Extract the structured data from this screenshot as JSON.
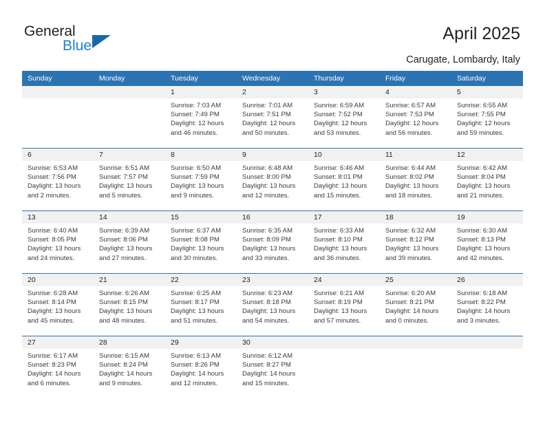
{
  "brand": {
    "name_part1": "General",
    "name_part2": "Blue",
    "accent_color": "#1b7fd4",
    "triangle_color": "#1668ad"
  },
  "header": {
    "title": "April 2025",
    "location": "Carugate, Lombardy, Italy"
  },
  "calendar": {
    "header_color": "#2c73b4",
    "daynum_bg": "#f1f1f1",
    "weekdays": [
      "Sunday",
      "Monday",
      "Tuesday",
      "Wednesday",
      "Thursday",
      "Friday",
      "Saturday"
    ],
    "weeks": [
      [
        {
          "day": "",
          "sunrise": "",
          "sunset": "",
          "daylight_1": "",
          "daylight_2": ""
        },
        {
          "day": "",
          "sunrise": "",
          "sunset": "",
          "daylight_1": "",
          "daylight_2": ""
        },
        {
          "day": "1",
          "sunrise": "Sunrise: 7:03 AM",
          "sunset": "Sunset: 7:49 PM",
          "daylight_1": "Daylight: 12 hours",
          "daylight_2": "and 46 minutes."
        },
        {
          "day": "2",
          "sunrise": "Sunrise: 7:01 AM",
          "sunset": "Sunset: 7:51 PM",
          "daylight_1": "Daylight: 12 hours",
          "daylight_2": "and 50 minutes."
        },
        {
          "day": "3",
          "sunrise": "Sunrise: 6:59 AM",
          "sunset": "Sunset: 7:52 PM",
          "daylight_1": "Daylight: 12 hours",
          "daylight_2": "and 53 minutes."
        },
        {
          "day": "4",
          "sunrise": "Sunrise: 6:57 AM",
          "sunset": "Sunset: 7:53 PM",
          "daylight_1": "Daylight: 12 hours",
          "daylight_2": "and 56 minutes."
        },
        {
          "day": "5",
          "sunrise": "Sunrise: 6:55 AM",
          "sunset": "Sunset: 7:55 PM",
          "daylight_1": "Daylight: 12 hours",
          "daylight_2": "and 59 minutes."
        }
      ],
      [
        {
          "day": "6",
          "sunrise": "Sunrise: 6:53 AM",
          "sunset": "Sunset: 7:56 PM",
          "daylight_1": "Daylight: 13 hours",
          "daylight_2": "and 2 minutes."
        },
        {
          "day": "7",
          "sunrise": "Sunrise: 6:51 AM",
          "sunset": "Sunset: 7:57 PM",
          "daylight_1": "Daylight: 13 hours",
          "daylight_2": "and 5 minutes."
        },
        {
          "day": "8",
          "sunrise": "Sunrise: 6:50 AM",
          "sunset": "Sunset: 7:59 PM",
          "daylight_1": "Daylight: 13 hours",
          "daylight_2": "and 9 minutes."
        },
        {
          "day": "9",
          "sunrise": "Sunrise: 6:48 AM",
          "sunset": "Sunset: 8:00 PM",
          "daylight_1": "Daylight: 13 hours",
          "daylight_2": "and 12 minutes."
        },
        {
          "day": "10",
          "sunrise": "Sunrise: 6:46 AM",
          "sunset": "Sunset: 8:01 PM",
          "daylight_1": "Daylight: 13 hours",
          "daylight_2": "and 15 minutes."
        },
        {
          "day": "11",
          "sunrise": "Sunrise: 6:44 AM",
          "sunset": "Sunset: 8:02 PM",
          "daylight_1": "Daylight: 13 hours",
          "daylight_2": "and 18 minutes."
        },
        {
          "day": "12",
          "sunrise": "Sunrise: 6:42 AM",
          "sunset": "Sunset: 8:04 PM",
          "daylight_1": "Daylight: 13 hours",
          "daylight_2": "and 21 minutes."
        }
      ],
      [
        {
          "day": "13",
          "sunrise": "Sunrise: 6:40 AM",
          "sunset": "Sunset: 8:05 PM",
          "daylight_1": "Daylight: 13 hours",
          "daylight_2": "and 24 minutes."
        },
        {
          "day": "14",
          "sunrise": "Sunrise: 6:39 AM",
          "sunset": "Sunset: 8:06 PM",
          "daylight_1": "Daylight: 13 hours",
          "daylight_2": "and 27 minutes."
        },
        {
          "day": "15",
          "sunrise": "Sunrise: 6:37 AM",
          "sunset": "Sunset: 8:08 PM",
          "daylight_1": "Daylight: 13 hours",
          "daylight_2": "and 30 minutes."
        },
        {
          "day": "16",
          "sunrise": "Sunrise: 6:35 AM",
          "sunset": "Sunset: 8:09 PM",
          "daylight_1": "Daylight: 13 hours",
          "daylight_2": "and 33 minutes."
        },
        {
          "day": "17",
          "sunrise": "Sunrise: 6:33 AM",
          "sunset": "Sunset: 8:10 PM",
          "daylight_1": "Daylight: 13 hours",
          "daylight_2": "and 36 minutes."
        },
        {
          "day": "18",
          "sunrise": "Sunrise: 6:32 AM",
          "sunset": "Sunset: 8:12 PM",
          "daylight_1": "Daylight: 13 hours",
          "daylight_2": "and 39 minutes."
        },
        {
          "day": "19",
          "sunrise": "Sunrise: 6:30 AM",
          "sunset": "Sunset: 8:13 PM",
          "daylight_1": "Daylight: 13 hours",
          "daylight_2": "and 42 minutes."
        }
      ],
      [
        {
          "day": "20",
          "sunrise": "Sunrise: 6:28 AM",
          "sunset": "Sunset: 8:14 PM",
          "daylight_1": "Daylight: 13 hours",
          "daylight_2": "and 45 minutes."
        },
        {
          "day": "21",
          "sunrise": "Sunrise: 6:26 AM",
          "sunset": "Sunset: 8:15 PM",
          "daylight_1": "Daylight: 13 hours",
          "daylight_2": "and 48 minutes."
        },
        {
          "day": "22",
          "sunrise": "Sunrise: 6:25 AM",
          "sunset": "Sunset: 8:17 PM",
          "daylight_1": "Daylight: 13 hours",
          "daylight_2": "and 51 minutes."
        },
        {
          "day": "23",
          "sunrise": "Sunrise: 6:23 AM",
          "sunset": "Sunset: 8:18 PM",
          "daylight_1": "Daylight: 13 hours",
          "daylight_2": "and 54 minutes."
        },
        {
          "day": "24",
          "sunrise": "Sunrise: 6:21 AM",
          "sunset": "Sunset: 8:19 PM",
          "daylight_1": "Daylight: 13 hours",
          "daylight_2": "and 57 minutes."
        },
        {
          "day": "25",
          "sunrise": "Sunrise: 6:20 AM",
          "sunset": "Sunset: 8:21 PM",
          "daylight_1": "Daylight: 14 hours",
          "daylight_2": "and 0 minutes."
        },
        {
          "day": "26",
          "sunrise": "Sunrise: 6:18 AM",
          "sunset": "Sunset: 8:22 PM",
          "daylight_1": "Daylight: 14 hours",
          "daylight_2": "and 3 minutes."
        }
      ],
      [
        {
          "day": "27",
          "sunrise": "Sunrise: 6:17 AM",
          "sunset": "Sunset: 8:23 PM",
          "daylight_1": "Daylight: 14 hours",
          "daylight_2": "and 6 minutes."
        },
        {
          "day": "28",
          "sunrise": "Sunrise: 6:15 AM",
          "sunset": "Sunset: 8:24 PM",
          "daylight_1": "Daylight: 14 hours",
          "daylight_2": "and 9 minutes."
        },
        {
          "day": "29",
          "sunrise": "Sunrise: 6:13 AM",
          "sunset": "Sunset: 8:26 PM",
          "daylight_1": "Daylight: 14 hours",
          "daylight_2": "and 12 minutes."
        },
        {
          "day": "30",
          "sunrise": "Sunrise: 6:12 AM",
          "sunset": "Sunset: 8:27 PM",
          "daylight_1": "Daylight: 14 hours",
          "daylight_2": "and 15 minutes."
        },
        {
          "day": "",
          "sunrise": "",
          "sunset": "",
          "daylight_1": "",
          "daylight_2": ""
        },
        {
          "day": "",
          "sunrise": "",
          "sunset": "",
          "daylight_1": "",
          "daylight_2": ""
        },
        {
          "day": "",
          "sunrise": "",
          "sunset": "",
          "daylight_1": "",
          "daylight_2": ""
        }
      ]
    ]
  }
}
